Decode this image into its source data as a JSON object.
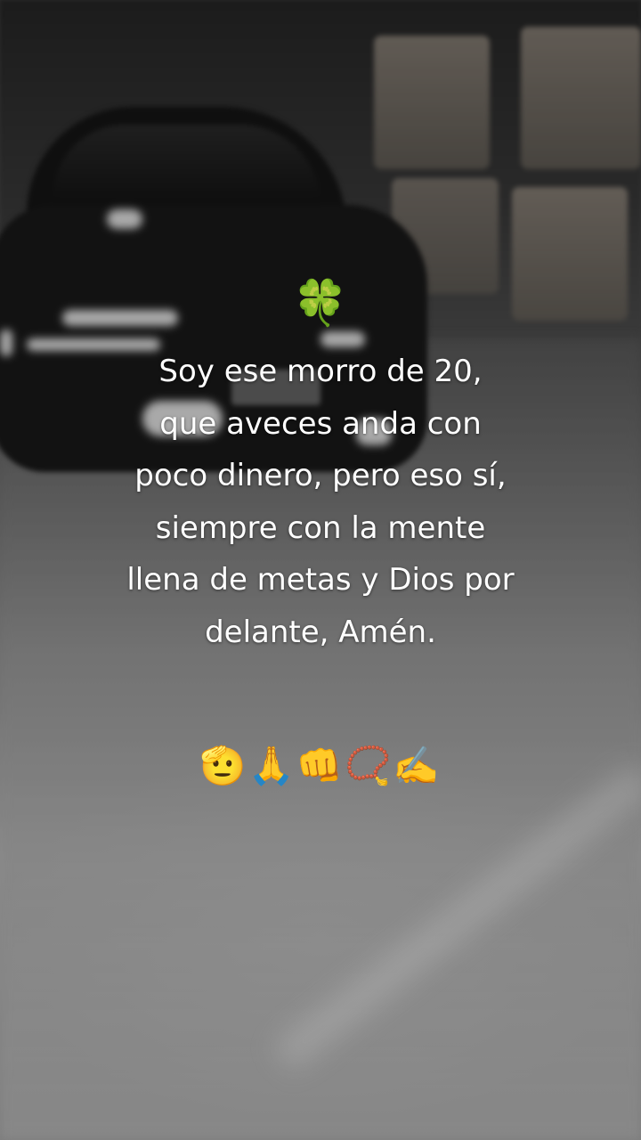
{
  "overlay": {
    "top_emoji": "🍀",
    "quote": "Soy ese morro de 20,\nque aveces anda con\npoco dinero, pero eso sí,\nsiempre con la mente\nllena de metas y Dios por\ndelante, Amén.",
    "bottom_emojis": "🫡🙏👊📿✍️"
  }
}
